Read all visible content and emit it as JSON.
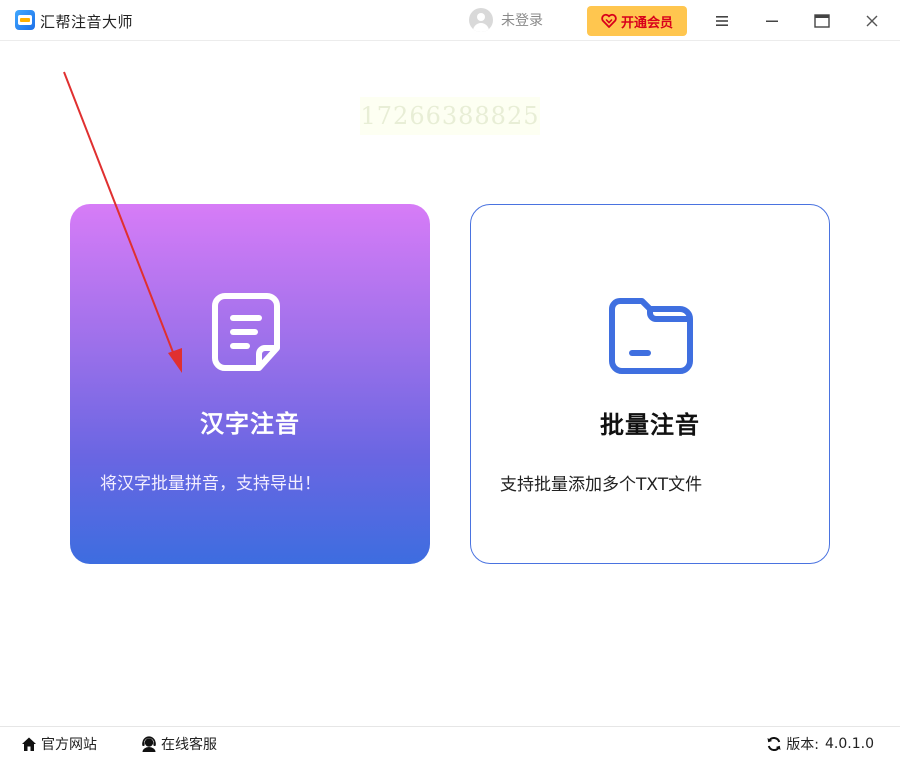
{
  "titlebar": {
    "app_title": "汇帮注音大师",
    "user_label": "未登录",
    "vip_label": "开通会员",
    "icons": {
      "logo": "app-logo-icon",
      "avatar": "user-avatar-icon",
      "vip": "heart-diamond-icon",
      "menu": "menu-icon",
      "minimize": "minimize-icon",
      "maximize": "maximize-icon",
      "close": "close-icon"
    }
  },
  "watermark": {
    "text": "17266388825"
  },
  "cards": [
    {
      "title": "汉字注音",
      "description": "将汉字批量拼音，支持导出！",
      "icon": "document-icon"
    },
    {
      "title": "批量注音",
      "description": "支持批量添加多个TXT文件",
      "icon": "folder-icon"
    }
  ],
  "footer": {
    "website_label": "官方网站",
    "service_label": "在线客服",
    "version_label": "版本:",
    "version_value": "4.0.1.0",
    "icons": {
      "website": "home-icon",
      "service": "customer-service-icon",
      "version": "refresh-icon"
    }
  },
  "colors": {
    "card_gradient_top": "#d77cf7",
    "card_gradient_bottom": "#3d6de0",
    "card_border": "#4a73e0",
    "vip_bg": "#ffc64f",
    "vip_text": "#d9001b",
    "arrow": "#e03030"
  }
}
